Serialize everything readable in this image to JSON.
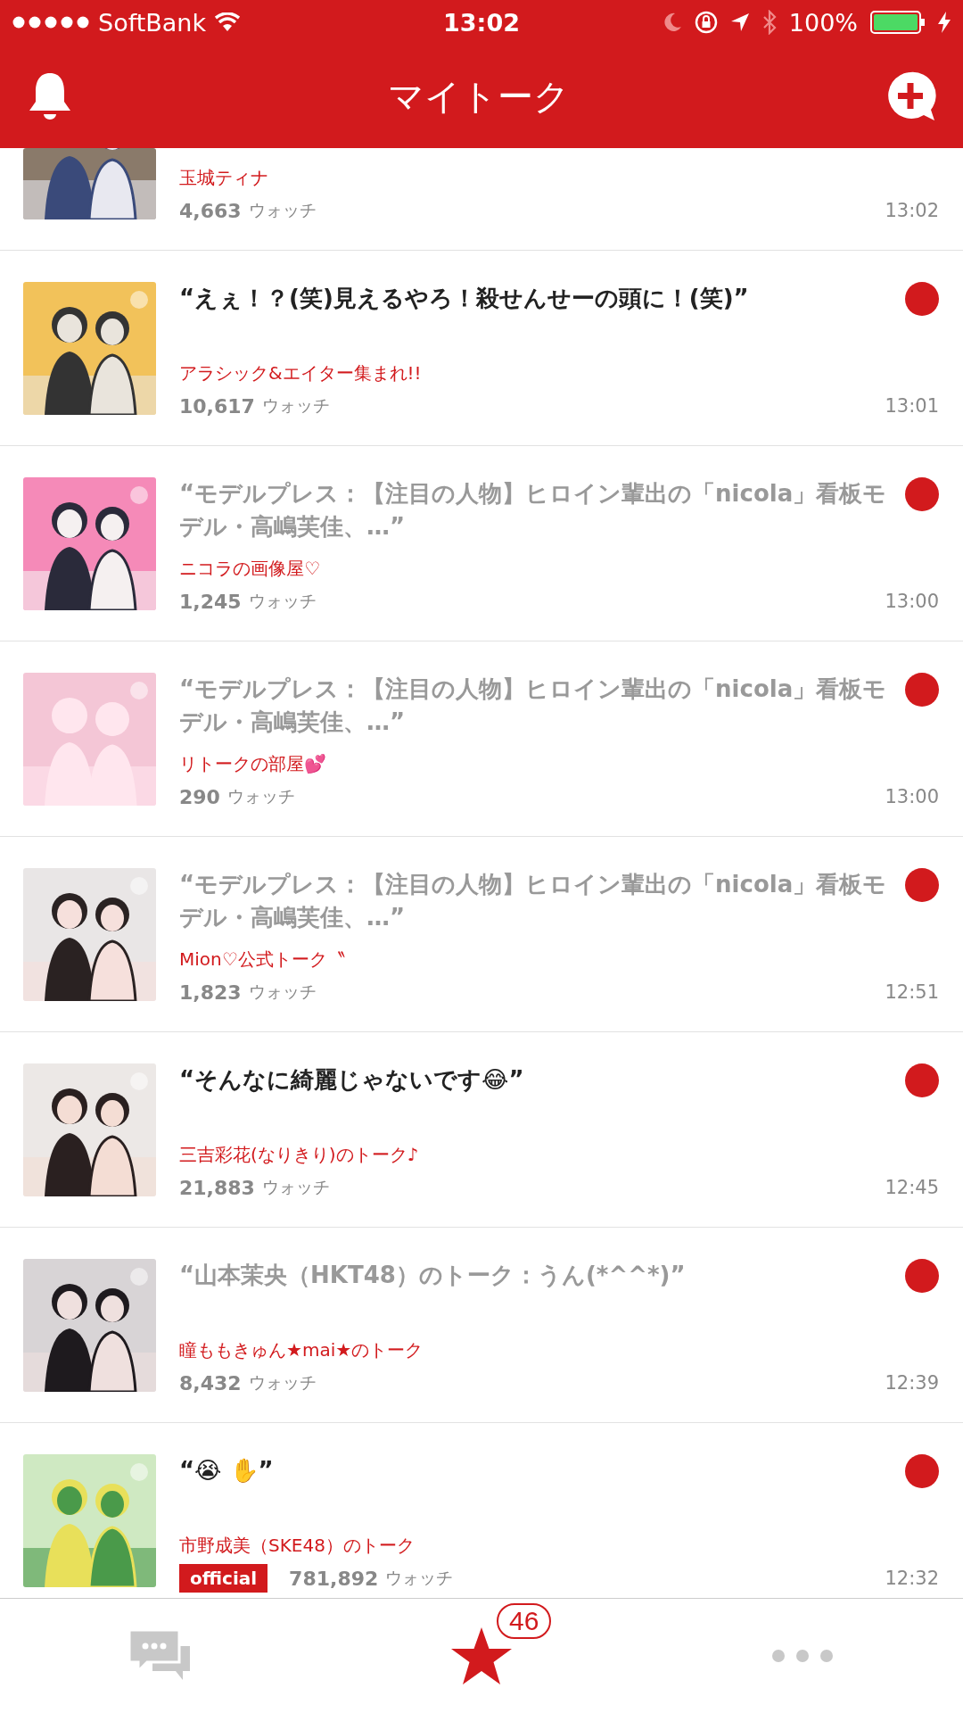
{
  "status_bar": {
    "carrier": "SoftBank",
    "time": "13:02",
    "battery": "100%"
  },
  "header": {
    "title": "マイトーク"
  },
  "talks": [
    {
      "source": "玉城ティナ",
      "watch_count": "4,663",
      "watch_label": "ウォッチ",
      "time": "13:02"
    },
    {
      "title": "“えぇ！？(笑)見えるやろ！殺せんせーの頭に！(笑)”",
      "source": "アラシック&エイター集まれ!!",
      "watch_count": "10,617",
      "watch_label": "ウォッチ",
      "time": "13:01",
      "dimmed": false,
      "new": true
    },
    {
      "title": "“モデルプレス：【注目の人物】ヒロイン輩出の「nicola」看板モデル・高嶋芙佳、…”",
      "source": "ニコラの画像屋♡",
      "watch_count": "1,245",
      "watch_label": "ウォッチ",
      "time": "13:00",
      "dimmed": true,
      "new": true
    },
    {
      "title": "“モデルプレス：【注目の人物】ヒロイン輩出の「nicola」看板モデル・高嶋芙佳、…”",
      "source": "リトークの部屋💕",
      "watch_count": "290",
      "watch_label": "ウォッチ",
      "time": "13:00",
      "dimmed": true,
      "new": true
    },
    {
      "title": "“モデルプレス：【注目の人物】ヒロイン輩出の「nicola」看板モデル・高嶋芙佳、…”",
      "source": "Mion♡公式トーク〝",
      "watch_count": "1,823",
      "watch_label": "ウォッチ",
      "time": "12:51",
      "dimmed": true,
      "new": true
    },
    {
      "title": "“そんなに綺麗じゃないです😂”",
      "source": "三吉彩花(なりきり)のトーク♪",
      "watch_count": "21,883",
      "watch_label": "ウォッチ",
      "time": "12:45",
      "dimmed": false,
      "new": true
    },
    {
      "title": "“山本茉央（HKT48）のトーク：うん(*^^*)”",
      "source": "瞳ももきゅん★mai★のトーク",
      "watch_count": "8,432",
      "watch_label": "ウォッチ",
      "time": "12:39",
      "dimmed": true,
      "new": true
    },
    {
      "title": "“😭 ✋”",
      "source": "市野成美（SKE48）のトーク",
      "badge": "official",
      "watch_count": "781,892",
      "watch_label": "ウォッチ",
      "time": "12:32",
      "dimmed": false,
      "new": true
    }
  ],
  "tab_bar": {
    "items": [
      {
        "kind": "chat",
        "selected": false
      },
      {
        "kind": "star",
        "selected": true,
        "badge": "46"
      },
      {
        "kind": "more",
        "selected": false
      }
    ]
  }
}
